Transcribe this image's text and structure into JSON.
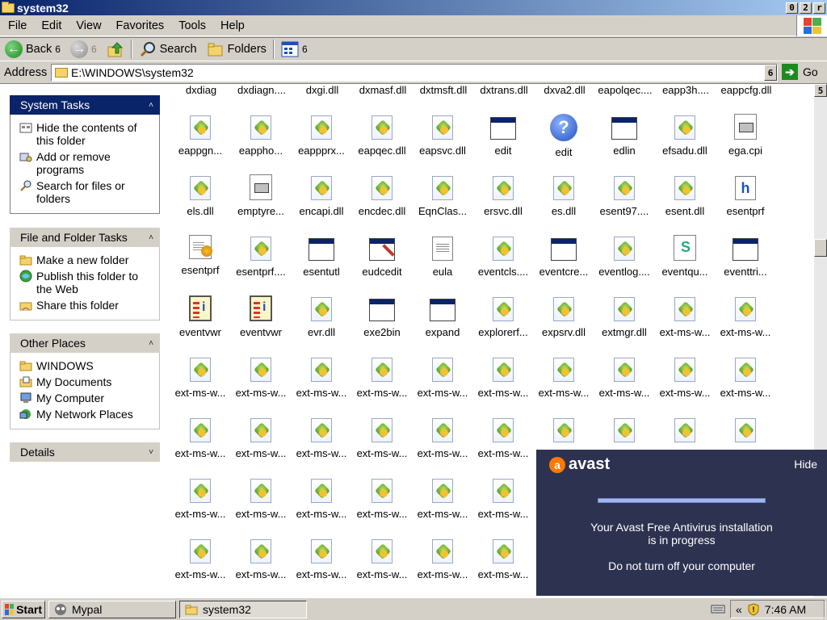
{
  "window": {
    "title": "system32",
    "controls": [
      "0",
      "2",
      "r"
    ]
  },
  "menu": [
    "File",
    "Edit",
    "View",
    "Favorites",
    "Tools",
    "Help"
  ],
  "toolbar": {
    "back_label": "Back",
    "back_drop": "6",
    "fwd_drop": "6",
    "search_label": "Search",
    "folders_label": "Folders",
    "views_drop": "6"
  },
  "address": {
    "label": "Address",
    "value": "E:\\WINDOWS\\system32",
    "drop": "6",
    "go_label": "Go"
  },
  "tasks": {
    "system": {
      "title": "System Tasks",
      "items": [
        "Hide the contents of this folder",
        "Add or remove programs",
        "Search for files or folders"
      ]
    },
    "file": {
      "title": "File and Folder Tasks",
      "items": [
        "Make a new folder",
        "Publish this folder to the Web",
        "Share this folder"
      ]
    },
    "other": {
      "title": "Other Places",
      "items": [
        "WINDOWS",
        "My Documents",
        "My Computer",
        "My Network Places"
      ]
    },
    "details": {
      "title": "Details"
    }
  },
  "files": {
    "top_row": [
      "dxdiag",
      "dxdiagn....",
      "dxgi.dll",
      "dxmasf.dll",
      "dxtmsft.dll",
      "dxtrans.dll",
      "dxva2.dll",
      "eapolqec....",
      "eapp3h....",
      "eappcfg.dll"
    ],
    "rows": [
      [
        {
          "name": "eappgn...",
          "icon": "dll"
        },
        {
          "name": "eappho...",
          "icon": "dll"
        },
        {
          "name": "eappprx...",
          "icon": "dll"
        },
        {
          "name": "eapqec.dll",
          "icon": "dll"
        },
        {
          "name": "eapsvc.dll",
          "icon": "dll"
        },
        {
          "name": "edit",
          "icon": "exe"
        },
        {
          "name": "edit",
          "icon": "help"
        },
        {
          "name": "edlin",
          "icon": "exe"
        },
        {
          "name": "efsadu.dll",
          "icon": "dll"
        },
        {
          "name": "ega.cpi",
          "icon": "cpi"
        }
      ],
      [
        {
          "name": "els.dll",
          "icon": "dll"
        },
        {
          "name": "emptyre...",
          "icon": "cpi"
        },
        {
          "name": "encapi.dll",
          "icon": "dll"
        },
        {
          "name": "encdec.dll",
          "icon": "dll"
        },
        {
          "name": "EqnClas...",
          "icon": "dll"
        },
        {
          "name": "ersvc.dll",
          "icon": "dll"
        },
        {
          "name": "es.dll",
          "icon": "dll"
        },
        {
          "name": "esent97....",
          "icon": "dll"
        },
        {
          "name": "esent.dll",
          "icon": "dll"
        },
        {
          "name": "esentprf",
          "icon": "hfile"
        }
      ],
      [
        {
          "name": "esentprf",
          "icon": "prf"
        },
        {
          "name": "esentprf....",
          "icon": "dll"
        },
        {
          "name": "esentutl",
          "icon": "exe"
        },
        {
          "name": "eudcedit",
          "icon": "edit"
        },
        {
          "name": "eula",
          "icon": "txt"
        },
        {
          "name": "eventcls....",
          "icon": "dll"
        },
        {
          "name": "eventcre...",
          "icon": "exe"
        },
        {
          "name": "eventlog....",
          "icon": "dll"
        },
        {
          "name": "eventqu...",
          "icon": "scr"
        },
        {
          "name": "eventtri...",
          "icon": "exe"
        }
      ],
      [
        {
          "name": "eventvwr",
          "icon": "log"
        },
        {
          "name": "eventvwr",
          "icon": "log"
        },
        {
          "name": "evr.dll",
          "icon": "dll"
        },
        {
          "name": "exe2bin",
          "icon": "exe"
        },
        {
          "name": "expand",
          "icon": "exe"
        },
        {
          "name": "explorerf...",
          "icon": "dll"
        },
        {
          "name": "expsrv.dll",
          "icon": "dll"
        },
        {
          "name": "extmgr.dll",
          "icon": "dll"
        },
        {
          "name": "ext-ms-w...",
          "icon": "dll"
        },
        {
          "name": "ext-ms-w...",
          "icon": "dll"
        }
      ],
      [
        {
          "name": "ext-ms-w...",
          "icon": "dll"
        },
        {
          "name": "ext-ms-w...",
          "icon": "dll"
        },
        {
          "name": "ext-ms-w...",
          "icon": "dll"
        },
        {
          "name": "ext-ms-w...",
          "icon": "dll"
        },
        {
          "name": "ext-ms-w...",
          "icon": "dll"
        },
        {
          "name": "ext-ms-w...",
          "icon": "dll"
        },
        {
          "name": "ext-ms-w...",
          "icon": "dll"
        },
        {
          "name": "ext-ms-w...",
          "icon": "dll"
        },
        {
          "name": "ext-ms-w...",
          "icon": "dll"
        },
        {
          "name": "ext-ms-w...",
          "icon": "dll"
        }
      ],
      [
        {
          "name": "ext-ms-w...",
          "icon": "dll"
        },
        {
          "name": "ext-ms-w...",
          "icon": "dll"
        },
        {
          "name": "ext-ms-w...",
          "icon": "dll"
        },
        {
          "name": "ext-ms-w...",
          "icon": "dll"
        },
        {
          "name": "ext-ms-w...",
          "icon": "dll"
        },
        {
          "name": "ext-ms-w...",
          "icon": "dll"
        },
        {
          "name": "",
          "icon": "dll"
        },
        {
          "name": "",
          "icon": "dll"
        },
        {
          "name": "",
          "icon": "dll"
        },
        {
          "name": "",
          "icon": "dll"
        }
      ],
      [
        {
          "name": "ext-ms-w...",
          "icon": "dll"
        },
        {
          "name": "ext-ms-w...",
          "icon": "dll"
        },
        {
          "name": "ext-ms-w...",
          "icon": "dll"
        },
        {
          "name": "ext-ms-w...",
          "icon": "dll"
        },
        {
          "name": "ext-ms-w...",
          "icon": "dll"
        },
        {
          "name": "ext-ms-w...",
          "icon": "dll"
        }
      ],
      [
        {
          "name": "ext-ms-w...",
          "icon": "dll"
        },
        {
          "name": "ext-ms-w...",
          "icon": "dll"
        },
        {
          "name": "ext-ms-w...",
          "icon": "dll"
        },
        {
          "name": "ext-ms-w...",
          "icon": "dll"
        },
        {
          "name": "ext-ms-w...",
          "icon": "dll"
        },
        {
          "name": "ext-ms-w...",
          "icon": "dll"
        }
      ]
    ]
  },
  "scrollbar": {
    "up_glyph": "5"
  },
  "avast": {
    "brand": "avast",
    "hide_label": "Hide",
    "progress": 1.0,
    "message_line1": "Your Avast Free Antivirus installation",
    "message_line2": "is in progress",
    "warning": "Do not turn off your computer"
  },
  "taskbar": {
    "start_label": "Start",
    "tasks": [
      {
        "label": "Mypal",
        "icon": "mypal-icon",
        "active": false
      },
      {
        "label": "system32",
        "icon": "folder-icon",
        "active": true
      }
    ],
    "tray_chevron": "«",
    "clock": "7:46 AM"
  },
  "colors": {
    "title_start": "#0a246a",
    "title_end": "#a6caf0",
    "avast_bg": "#2d3250",
    "avast_orange": "#ff7800"
  }
}
